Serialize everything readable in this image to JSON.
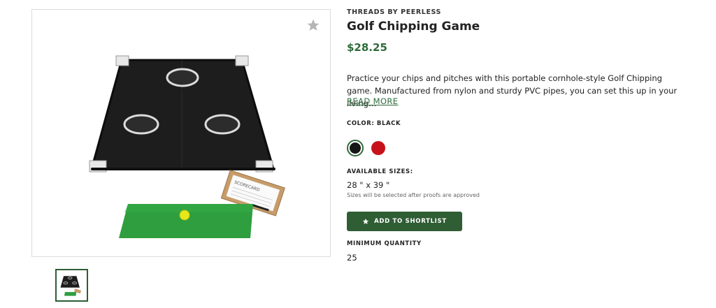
{
  "product": {
    "brand": "THREADS BY PEERLESS",
    "title": "Golf Chipping Game",
    "price": "$28.25",
    "description": "Practice your chips and pitches with this portable cornhole-style Golf Chipping game. Manufactured from nylon and sturdy PVC pipes, you can set this up in your living…",
    "read_more": "READ MORE",
    "scorecard_text": "SCORECARD"
  },
  "color": {
    "label": "COLOR: BLACK",
    "options": [
      {
        "name": "Black",
        "hex": "#161616",
        "selected": true
      },
      {
        "name": "Red",
        "hex": "#c8121b",
        "selected": false
      }
    ]
  },
  "sizes": {
    "label": "AVAILABLE SIZES:",
    "value": "28 \" x 39 \"",
    "note": "Sizes will be selected after proofs are approved"
  },
  "actions": {
    "add_to_shortlist": "ADD TO SHORTLIST",
    "favorite_icon": "star-icon"
  },
  "minimum": {
    "label": "MINIMUM QUANTITY",
    "value": "25"
  },
  "colors": {
    "accent": "#2f5d34",
    "price": "#2f6b3a"
  }
}
